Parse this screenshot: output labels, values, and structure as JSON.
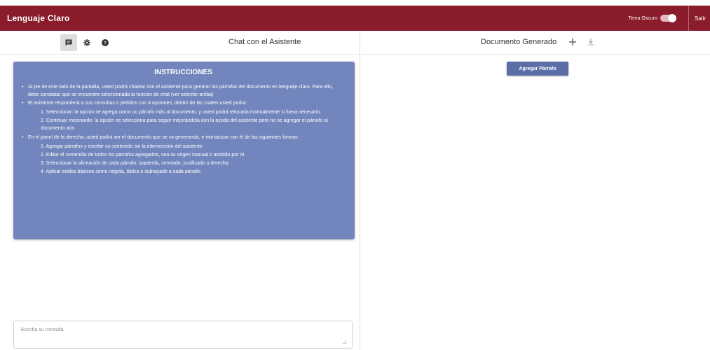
{
  "app": {
    "title": "Lenguaje Claro",
    "theme_toggle_label": "Tema Oscuro",
    "theme_dark_enabled": true,
    "logout_label": "Salir"
  },
  "left_panel": {
    "tools": [
      {
        "icon": "chat-icon",
        "active": true
      },
      {
        "icon": "gear-icon",
        "active": false
      },
      {
        "icon": "help-icon",
        "active": false
      }
    ],
    "title": "Chat con el Asistente",
    "instructions": {
      "title": "INSTRUCCIONES",
      "items": [
        {
          "text": "Al pie de este lado de la pantalla, usted podrá chatear con el asistente para generar los párrafos del documento en lenguaje claro. Para ello, debe constatar que se encuentre seleccionada la funcion de chat (ver selector arriba)"
        },
        {
          "text": "El asistente responderá a sus consultas o pedidos con 4 opciones, dentro de las cuales usted podra:",
          "sub": [
            "1. Seleccionar: la opción se agrega como un párrafo más al documento, y usted podrá retocarla manualmente si fuera necesario.",
            "2. Continuar mejorando: la opción se selecciona para seguir mejorándola con la ayuda del asistente pero no se agregar el párrafo al documento aún."
          ]
        },
        {
          "text": "En el panel de la derecha, usted podrá ver el documento que se va generando, e interactuar con él de las siguientes formas:",
          "sub": [
            "1. Agregar párrafos y escribir su contenido sin la intervención del asistente",
            "2. Editar el contenido de todos los párrafos agregados, sea su origen manual o asistido por AI",
            "3. Seleccionar la alineación de cada párrafo: izquierda, centrado, justificado o derecha",
            "4. Aplicar estilos básicos como negrita, itálica o subrayado a cada párrafo"
          ]
        }
      ]
    },
    "query_placeholder": "Escriba su consulta"
  },
  "right_panel": {
    "title": "Documento Generado",
    "add_icon": "plus-icon",
    "download_icon": "download-icon",
    "add_paragraph_label": "Agregar Párrafo"
  },
  "colors": {
    "topbar": "#8a1c2b",
    "instructions_bg": "#7285bd",
    "button_bg": "#5b6ea8"
  }
}
